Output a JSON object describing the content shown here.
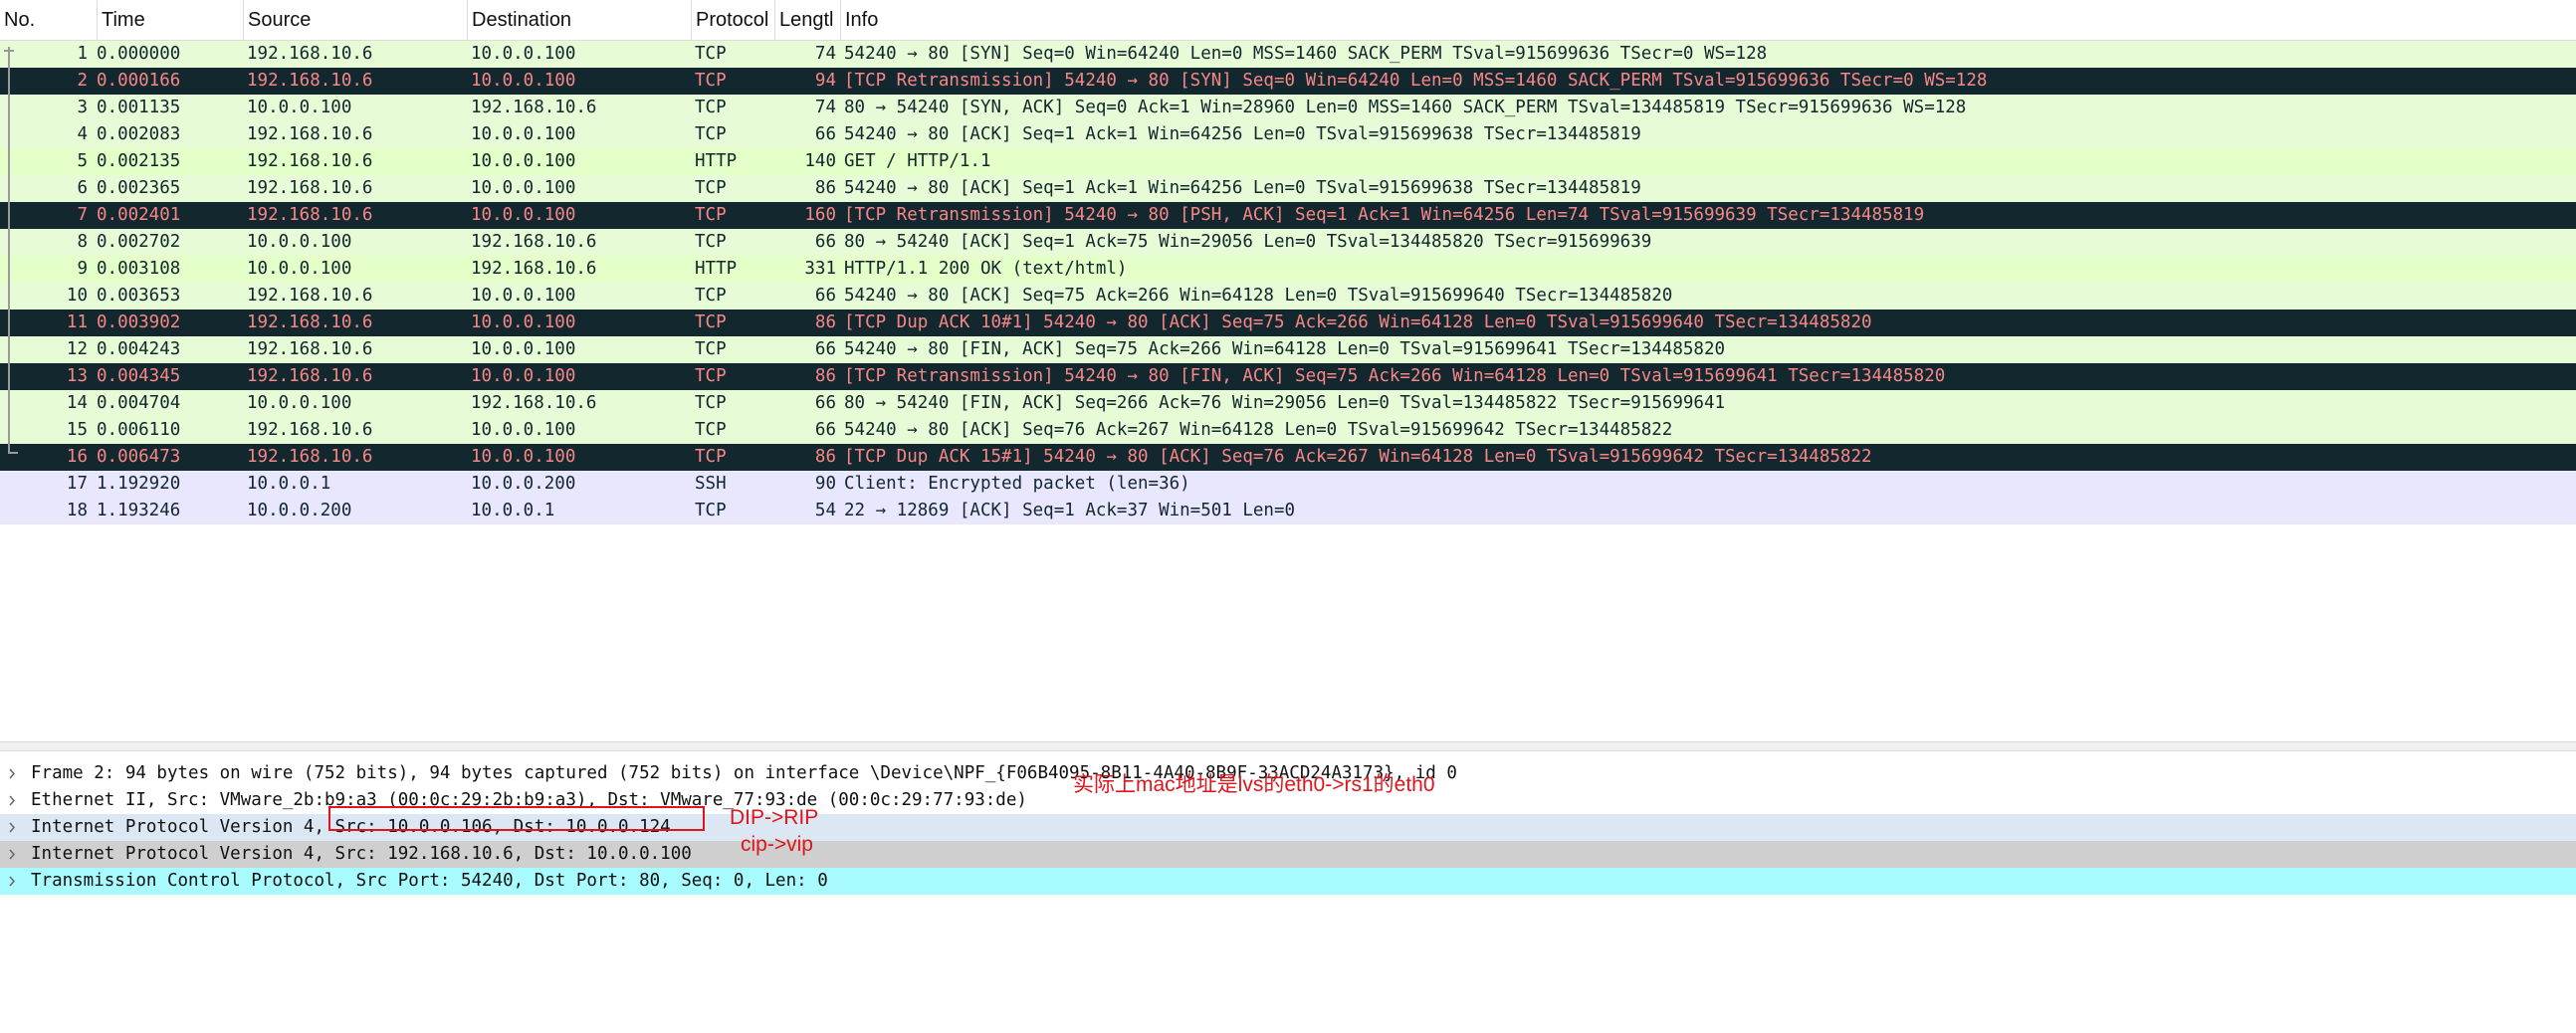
{
  "columns": {
    "no": "No.",
    "time": "Time",
    "source": "Source",
    "destination": "Destination",
    "protocol": "Protocol",
    "length": "Lengtl",
    "info": "Info"
  },
  "colors": {
    "tcp_row_bg": "#e7fbd6",
    "http_row_bg": "#e4ffc7",
    "bad_tcp_bg": "#12272e",
    "bad_tcp_fg": "#f78787",
    "ssh_row_bg": "#e8e7fd",
    "annotation_red": "#e0151b"
  },
  "packets": [
    {
      "no": "1",
      "time": "0.000000",
      "src": "192.168.10.6",
      "dst": "10.0.0.100",
      "proto": "TCP",
      "len": "74",
      "info": "54240 → 80 [SYN] Seq=0 Win=64240 Len=0 MSS=1460 SACK_PERM TSval=915699636 TSecr=0 WS=128",
      "style": "tcp"
    },
    {
      "no": "2",
      "time": "0.000166",
      "src": "192.168.10.6",
      "dst": "10.0.0.100",
      "proto": "TCP",
      "len": "94",
      "info": "[TCP Retransmission] 54240 → 80 [SYN] Seq=0 Win=64240 Len=0 MSS=1460 SACK_PERM TSval=915699636 TSecr=0 WS=128",
      "style": "bad"
    },
    {
      "no": "3",
      "time": "0.001135",
      "src": "10.0.0.100",
      "dst": "192.168.10.6",
      "proto": "TCP",
      "len": "74",
      "info": "80 → 54240 [SYN, ACK] Seq=0 Ack=1 Win=28960 Len=0 MSS=1460 SACK_PERM TSval=134485819 TSecr=915699636 WS=128",
      "style": "tcp"
    },
    {
      "no": "4",
      "time": "0.002083",
      "src": "192.168.10.6",
      "dst": "10.0.0.100",
      "proto": "TCP",
      "len": "66",
      "info": "54240 → 80 [ACK] Seq=1 Ack=1 Win=64256 Len=0 TSval=915699638 TSecr=134485819",
      "style": "tcp"
    },
    {
      "no": "5",
      "time": "0.002135",
      "src": "192.168.10.6",
      "dst": "10.0.0.100",
      "proto": "HTTP",
      "len": "140",
      "info": "GET / HTTP/1.1",
      "style": "http"
    },
    {
      "no": "6",
      "time": "0.002365",
      "src": "192.168.10.6",
      "dst": "10.0.0.100",
      "proto": "TCP",
      "len": "86",
      "info": "54240 → 80 [ACK] Seq=1 Ack=1 Win=64256 Len=0 TSval=915699638 TSecr=134485819",
      "style": "tcp"
    },
    {
      "no": "7",
      "time": "0.002401",
      "src": "192.168.10.6",
      "dst": "10.0.0.100",
      "proto": "TCP",
      "len": "160",
      "info": "[TCP Retransmission] 54240 → 80 [PSH, ACK] Seq=1 Ack=1 Win=64256 Len=74 TSval=915699639 TSecr=134485819",
      "style": "bad"
    },
    {
      "no": "8",
      "time": "0.002702",
      "src": "10.0.0.100",
      "dst": "192.168.10.6",
      "proto": "TCP",
      "len": "66",
      "info": "80 → 54240 [ACK] Seq=1 Ack=75 Win=29056 Len=0 TSval=134485820 TSecr=915699639",
      "style": "tcp"
    },
    {
      "no": "9",
      "time": "0.003108",
      "src": "10.0.0.100",
      "dst": "192.168.10.6",
      "proto": "HTTP",
      "len": "331",
      "info": "HTTP/1.1 200 OK  (text/html)",
      "style": "http"
    },
    {
      "no": "10",
      "time": "0.003653",
      "src": "192.168.10.6",
      "dst": "10.0.0.100",
      "proto": "TCP",
      "len": "66",
      "info": "54240 → 80 [ACK] Seq=75 Ack=266 Win=64128 Len=0 TSval=915699640 TSecr=134485820",
      "style": "tcp"
    },
    {
      "no": "11",
      "time": "0.003902",
      "src": "192.168.10.6",
      "dst": "10.0.0.100",
      "proto": "TCP",
      "len": "86",
      "info": "[TCP Dup ACK 10#1] 54240 → 80 [ACK] Seq=75 Ack=266 Win=64128 Len=0 TSval=915699640 TSecr=134485820",
      "style": "bad"
    },
    {
      "no": "12",
      "time": "0.004243",
      "src": "192.168.10.6",
      "dst": "10.0.0.100",
      "proto": "TCP",
      "len": "66",
      "info": "54240 → 80 [FIN, ACK] Seq=75 Ack=266 Win=64128 Len=0 TSval=915699641 TSecr=134485820",
      "style": "tcp"
    },
    {
      "no": "13",
      "time": "0.004345",
      "src": "192.168.10.6",
      "dst": "10.0.0.100",
      "proto": "TCP",
      "len": "86",
      "info": "[TCP Retransmission] 54240 → 80 [FIN, ACK] Seq=75 Ack=266 Win=64128 Len=0 TSval=915699641 TSecr=134485820",
      "style": "bad"
    },
    {
      "no": "14",
      "time": "0.004704",
      "src": "10.0.0.100",
      "dst": "192.168.10.6",
      "proto": "TCP",
      "len": "66",
      "info": "80 → 54240 [FIN, ACK] Seq=266 Ack=76 Win=29056 Len=0 TSval=134485822 TSecr=915699641",
      "style": "tcp"
    },
    {
      "no": "15",
      "time": "0.006110",
      "src": "192.168.10.6",
      "dst": "10.0.0.100",
      "proto": "TCP",
      "len": "66",
      "info": "54240 → 80 [ACK] Seq=76 Ack=267 Win=64128 Len=0 TSval=915699642 TSecr=134485822",
      "style": "tcp"
    },
    {
      "no": "16",
      "time": "0.006473",
      "src": "192.168.10.6",
      "dst": "10.0.0.100",
      "proto": "TCP",
      "len": "86",
      "info": "[TCP Dup ACK 15#1] 54240 → 80 [ACK] Seq=76 Ack=267 Win=64128 Len=0 TSval=915699642 TSecr=134485822",
      "style": "bad"
    },
    {
      "no": "17",
      "time": "1.192920",
      "src": "10.0.0.1",
      "dst": "10.0.0.200",
      "proto": "SSH",
      "len": "90",
      "info": "Client: Encrypted packet (len=36)",
      "style": "ssh"
    },
    {
      "no": "18",
      "time": "1.193246",
      "src": "10.0.0.200",
      "dst": "10.0.0.1",
      "proto": "TCP",
      "len": "54",
      "info": "22 → 12869 [ACK] Seq=1 Ack=37 Win=501 Len=0",
      "style": "ssh"
    }
  ],
  "details": [
    {
      "text": "Frame 2: 94 bytes on wire (752 bits), 94 bytes captured (752 bits) on interface \\Device\\NPF_{F06B4095-8B11-4A40-8B9F-33ACD24A3173}, id 0",
      "style": "plain"
    },
    {
      "text": "Ethernet II, Src: VMware_2b:b9:a3 (00:0c:29:2b:b9:a3), Dst: VMware_77:93:de (00:0c:29:77:93:de)",
      "style": "plain"
    },
    {
      "text": "Internet Protocol Version 4, Src: 10.0.0.106, Dst: 10.0.0.124",
      "style": "ip1"
    },
    {
      "text": "Internet Protocol Version 4, Src: 192.168.10.6, Dst: 10.0.0.100",
      "style": "ip2"
    },
    {
      "text": "Transmission Control Protocol, Src Port: 54240, Dst Port: 80, Seq: 0, Len: 0",
      "style": "tcp"
    }
  ],
  "annotations": {
    "mac_note": "实际上mac地址是lvs的eth0->rs1的eth0",
    "dip_rip": "DIP->RIP",
    "cip_vip": "cip->vip"
  }
}
